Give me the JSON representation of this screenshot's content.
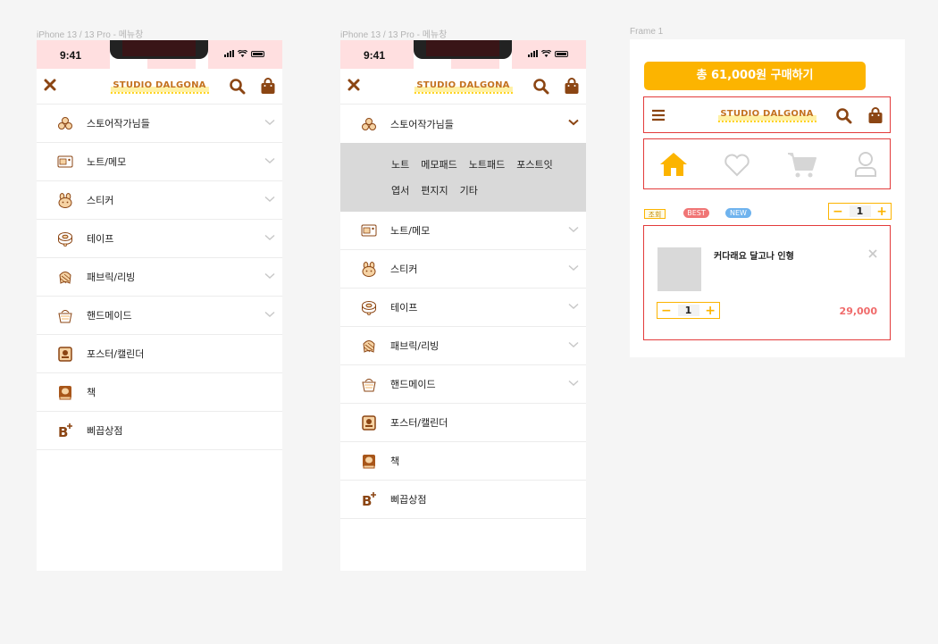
{
  "frames": {
    "phone1_label": "iPhone 13 / 13 Pro - 메뉴창",
    "phone2_label": "iPhone 13 / 13 Pro - 메뉴창",
    "frame3_label": "Frame 1"
  },
  "status": {
    "time": "9:41"
  },
  "brand": {
    "logo": "STUDIO DALGONA"
  },
  "menu": {
    "items": [
      {
        "label": "스토어작가님들",
        "icon": "cookies-icon",
        "expandable": true
      },
      {
        "label": "노트/메모",
        "icon": "notebook-icon",
        "expandable": true
      },
      {
        "label": "스티커",
        "icon": "bunny-face-icon",
        "expandable": true
      },
      {
        "label": "테이프",
        "icon": "tape-icon",
        "expandable": true
      },
      {
        "label": "패브릭/리빙",
        "icon": "fabric-icon",
        "expandable": true
      },
      {
        "label": "핸드메이드",
        "icon": "basket-icon",
        "expandable": true
      },
      {
        "label": "포스터/캘린더",
        "icon": "poster-icon",
        "expandable": false
      },
      {
        "label": "책",
        "icon": "book-icon",
        "expandable": false
      },
      {
        "label": "삐끕상점",
        "icon": "b-plus-icon",
        "expandable": false
      }
    ],
    "submenu_row1": [
      "노트",
      "메모패드",
      "노트패드",
      "포스트잇"
    ],
    "submenu_row2": [
      "엽서",
      "편지지",
      "기타"
    ]
  },
  "cart": {
    "buy_button": "총 61,000원 구매하기",
    "chip_view": "조회",
    "chip_best": "BEST",
    "chip_new": "NEW",
    "top_qty": "1",
    "product_name": "커다래요 달고나 인형",
    "product_qty": "1",
    "product_price": "29,000"
  },
  "colors": {
    "accent": "#fcb400",
    "brand_brown": "#a8561a",
    "red_border": "#e33b3b",
    "price_red": "#f06b6b",
    "status_pink": "#ffdfe0"
  }
}
